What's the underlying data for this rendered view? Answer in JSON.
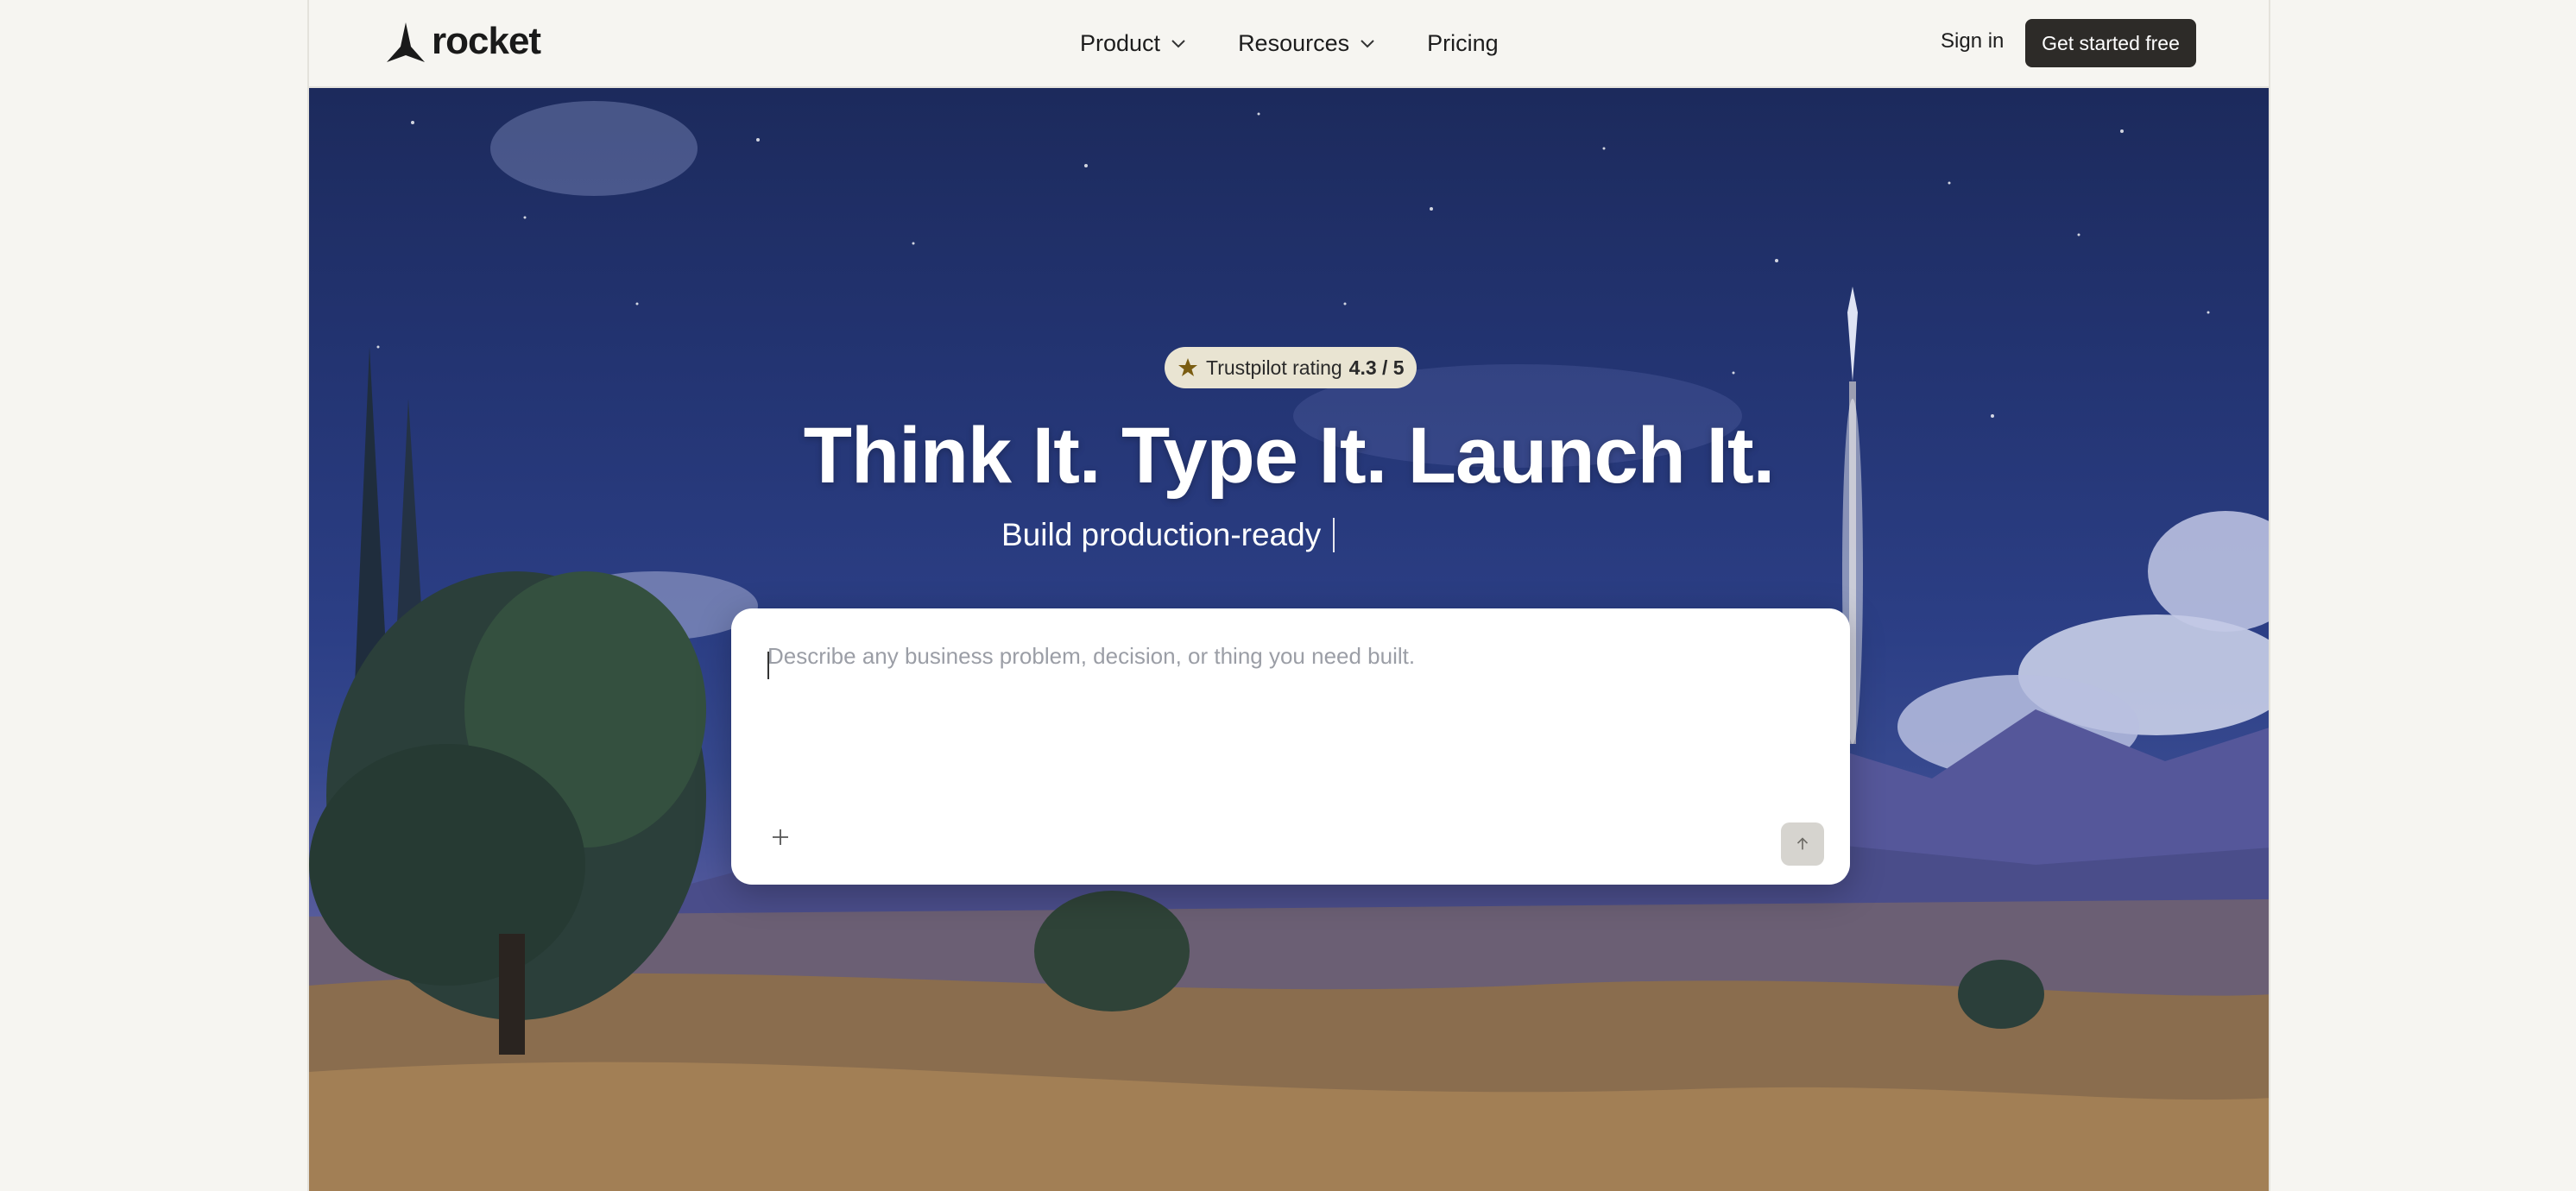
{
  "brand": {
    "name": "rocket",
    "logo_icon": "rocket-logo-icon"
  },
  "nav": {
    "items": [
      {
        "label": "Product",
        "icon": "chevron-down-icon"
      },
      {
        "label": "Resources",
        "icon": "chevron-down-icon"
      },
      {
        "label": "Pricing"
      }
    ],
    "sign_in": "Sign in",
    "cta": "Get started free"
  },
  "hero": {
    "badge": {
      "icon": "star-icon",
      "label": "Trustpilot rating",
      "rating": "4.3 / 5"
    },
    "headline": "Think It. Type It. Launch It.",
    "subline": "Build production-ready"
  },
  "prompt": {
    "placeholder": "Describe any business problem, decision, or thing you need built.",
    "value": "",
    "add_icon": "plus-icon",
    "send_icon": "arrow-up-icon"
  },
  "colors": {
    "page_bg": "#f6f5f1",
    "cta_bg": "#2d2b28",
    "badge_bg": "#e9e4d2",
    "sky_top": "#1c2a5c",
    "send_button_bg": "#d6d4cf"
  }
}
